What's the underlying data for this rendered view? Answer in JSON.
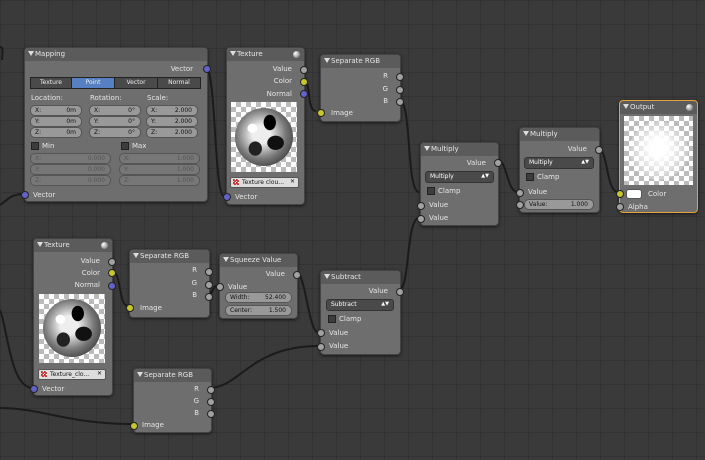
{
  "nodes": {
    "mapping": {
      "title": "Mapping",
      "output_vector": "Vector",
      "input_vector": "Vector",
      "tabs": [
        "Texture",
        "Point",
        "Vector",
        "Normal"
      ],
      "active_tab": "Point",
      "col_location": "Location:",
      "col_rotation": "Rotation:",
      "col_scale": "Scale:",
      "axes": [
        "X:",
        "Y:",
        "Z:"
      ],
      "location": [
        "0m",
        "0m",
        "0m"
      ],
      "rotation": [
        "0°",
        "0°",
        "0°"
      ],
      "scale": [
        "2.000",
        "2.000",
        "2.000"
      ],
      "min_label": "Min",
      "max_label": "Max",
      "min_values": [
        "0.000",
        "0.000",
        "0.000"
      ],
      "max_values": [
        "1.000",
        "1.000",
        "1.000"
      ]
    },
    "texture_top": {
      "title": "Texture",
      "out_value": "Value",
      "out_color": "Color",
      "out_normal": "Normal",
      "image_name": "Texture clou...",
      "in_vector": "Vector"
    },
    "separate_rgb_1": {
      "title": "Separate RGB",
      "out_r": "R",
      "out_g": "G",
      "out_b": "B",
      "in_image": "Image"
    },
    "texture_bottom": {
      "title": "Texture",
      "out_value": "Value",
      "out_color": "Color",
      "out_normal": "Normal",
      "image_name": "Texture_clo...",
      "in_vector": "Vector"
    },
    "separate_rgb_2": {
      "title": "Separate RGB",
      "out_r": "R",
      "out_g": "G",
      "out_b": "B",
      "in_image": "Image"
    },
    "squeeze_value": {
      "title": "Squeeze Value",
      "out_value": "Value",
      "in_value": "Value",
      "width_label": "Width:",
      "width_value": "52.400",
      "center_label": "Center:",
      "center_value": "1.500"
    },
    "subtract": {
      "title": "Subtract",
      "out_value": "Value",
      "operation": "Subtract",
      "clamp_label": "Clamp",
      "in_value_1": "Value",
      "in_value_2": "Value"
    },
    "separate_rgb_3": {
      "title": "Separate RGB",
      "out_r": "R",
      "out_g": "G",
      "out_b": "B",
      "in_image": "Image"
    },
    "multiply_1": {
      "title": "Multiply",
      "out_value": "Value",
      "operation": "Multiply",
      "clamp_label": "Clamp",
      "in_value_1": "Value",
      "in_value_2": "Value"
    },
    "multiply_2": {
      "title": "Multiply",
      "out_value": "Value",
      "operation": "Multiply",
      "clamp_label": "Clamp",
      "in_value_1": "Value",
      "in_value_2_label": "Value:",
      "in_value_2": "1.000"
    },
    "output": {
      "title": "Output",
      "in_color": "Color",
      "in_alpha": "Alpha"
    }
  },
  "colors": {
    "grid_bg": "#3a3a3a",
    "node_body": "#6e6e6e",
    "active_border": "#e2a43a",
    "active_tab": "#5680c2",
    "socket_grey": "#a1a1a1",
    "socket_yellow": "#c7c729",
    "socket_blue": "#6363c7"
  }
}
